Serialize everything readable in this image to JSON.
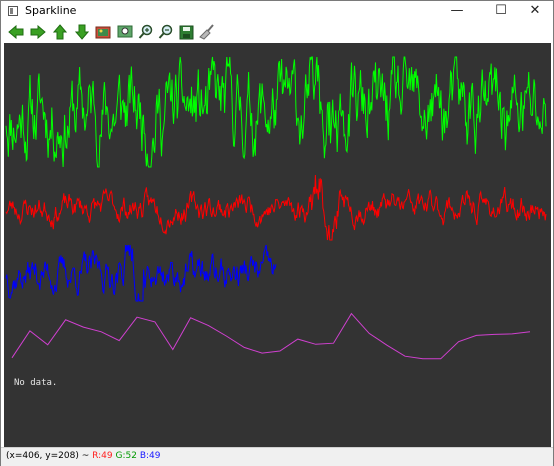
{
  "window": {
    "title": "Sparkline"
  },
  "window_controls": {
    "minimize": "—",
    "maximize": "☐",
    "close": "✕"
  },
  "toolbar": [
    {
      "name": "back-button",
      "icon": "arrow-left-icon"
    },
    {
      "name": "forward-button",
      "icon": "arrow-right-icon"
    },
    {
      "name": "up-button",
      "icon": "arrow-up-icon"
    },
    {
      "name": "down-button",
      "icon": "arrow-down-icon"
    },
    {
      "name": "image-button",
      "icon": "image-icon"
    },
    {
      "name": "fit-button",
      "icon": "zoom-fit-icon"
    },
    {
      "name": "zoom-in-button",
      "icon": "zoom-in-icon"
    },
    {
      "name": "zoom-out-button",
      "icon": "zoom-out-icon"
    },
    {
      "name": "save-button",
      "icon": "save-icon"
    },
    {
      "name": "clear-button",
      "icon": "broom-icon"
    }
  ],
  "canvas": {
    "background": "#333333",
    "no_data_text": "No data.",
    "series": [
      {
        "name": "green",
        "color": "#00ff00",
        "samples": 720,
        "base": 0.5,
        "noise": 0.22,
        "seed": 11
      },
      {
        "name": "red",
        "color": "#ff0000",
        "samples": 720,
        "base": 0.5,
        "noise": 0.12,
        "seed": 23
      },
      {
        "name": "blue",
        "color": "#0000ff",
        "samples": 360,
        "base": 0.5,
        "noise": 0.18,
        "seed": 37
      }
    ],
    "magenta_line": {
      "color": "#d040d0",
      "values": [
        0.1,
        0.62,
        0.35,
        0.83,
        0.69,
        0.6,
        0.43,
        0.88,
        0.79,
        0.26,
        0.87,
        0.72,
        0.52,
        0.3,
        0.19,
        0.23,
        0.46,
        0.36,
        0.38,
        0.95,
        0.57,
        0.34,
        0.13,
        0.08,
        0.08,
        0.41,
        0.53,
        0.55,
        0.56,
        0.6
      ]
    }
  },
  "statusbar": {
    "coords": "(x=406, y=208) ~",
    "r": "R:49",
    "g": "G:52",
    "b": "B:49"
  }
}
